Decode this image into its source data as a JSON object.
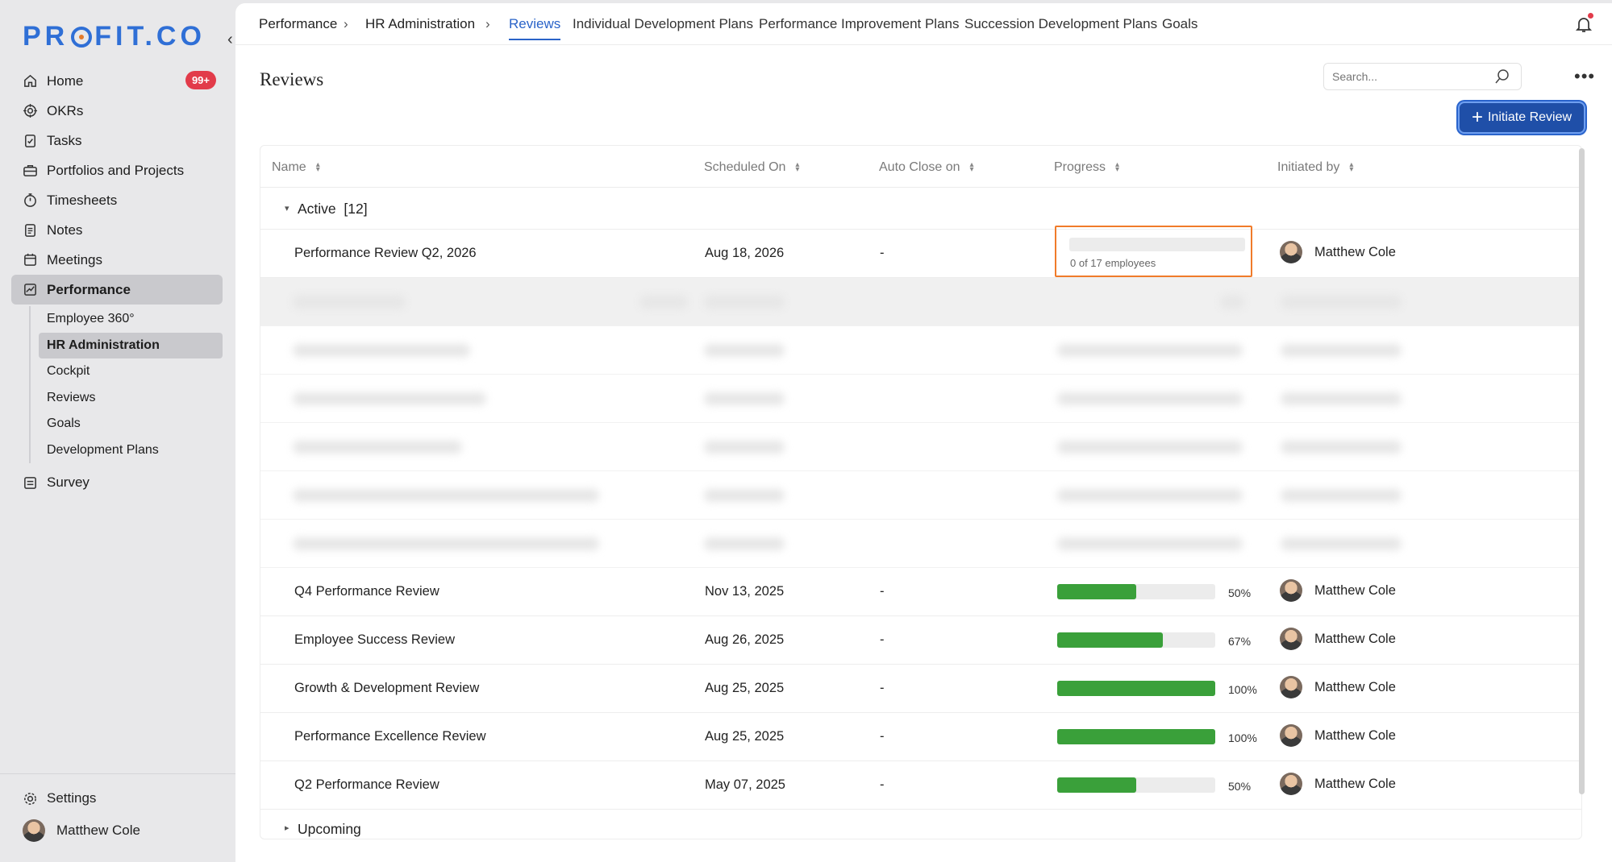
{
  "brand": {
    "logo_pre": "PR",
    "logo_post": "FIT.CO"
  },
  "sidebar": {
    "items": [
      {
        "label": "Home",
        "badge": "99+"
      },
      {
        "label": "OKRs"
      },
      {
        "label": "Tasks"
      },
      {
        "label": "Portfolios and Projects"
      },
      {
        "label": "Timesheets"
      },
      {
        "label": "Notes"
      },
      {
        "label": "Meetings"
      },
      {
        "label": "Performance"
      }
    ],
    "sub_items": [
      "Employee 360°",
      "HR Administration",
      "Cockpit",
      "Reviews",
      "Goals",
      "Development Plans"
    ],
    "survey": "Survey",
    "settings": "Settings",
    "user": "Matthew Cole"
  },
  "topbar": {
    "crumbs": [
      "Performance",
      "HR Administration"
    ],
    "tabs": [
      "Reviews",
      "Individual Development Plans",
      "Performance Improvement Plans",
      "Succession Development Plans",
      "Goals"
    ]
  },
  "page": {
    "title": "Reviews",
    "search_placeholder": "Search...",
    "initiate_label": "Initiate Review"
  },
  "table": {
    "headers": [
      "Name",
      "Scheduled On",
      "Auto Close on",
      "Progress",
      "Initiated by"
    ],
    "active_group": "Active",
    "active_count": "[12]",
    "upcoming_group": "Upcoming",
    "highlighted_row": {
      "name": "Performance Review Q2, 2026",
      "scheduled": "Aug 18, 2026",
      "auto_close": "-",
      "progress_text": "0 of 17 employees",
      "initiated_by": "Matthew Cole"
    },
    "rows": [
      {
        "name": "Q4 Performance Review",
        "scheduled": "Nov 13, 2025",
        "auto_close": "-",
        "progress": 50,
        "progress_label": "50%",
        "initiated_by": "Matthew Cole"
      },
      {
        "name": "Employee Success Review",
        "scheduled": "Aug 26, 2025",
        "auto_close": "-",
        "progress": 67,
        "progress_label": "67%",
        "initiated_by": "Matthew Cole"
      },
      {
        "name": "Growth & Development Review",
        "scheduled": "Aug 25, 2025",
        "auto_close": "-",
        "progress": 100,
        "progress_label": "100%",
        "initiated_by": "Matthew Cole"
      },
      {
        "name": "Performance Excellence Review",
        "scheduled": "Aug 25, 2025",
        "auto_close": "-",
        "progress": 100,
        "progress_label": "100%",
        "initiated_by": "Matthew Cole"
      },
      {
        "name": "Q2 Performance Review",
        "scheduled": "May 07, 2025",
        "auto_close": "-",
        "progress": 50,
        "progress_label": "50%",
        "initiated_by": "Matthew Cole"
      }
    ]
  },
  "colors": {
    "accent": "#2a63c8",
    "progress": "#3aa03a",
    "highlight": "#f07b2a",
    "badge": "#e23b4a"
  }
}
